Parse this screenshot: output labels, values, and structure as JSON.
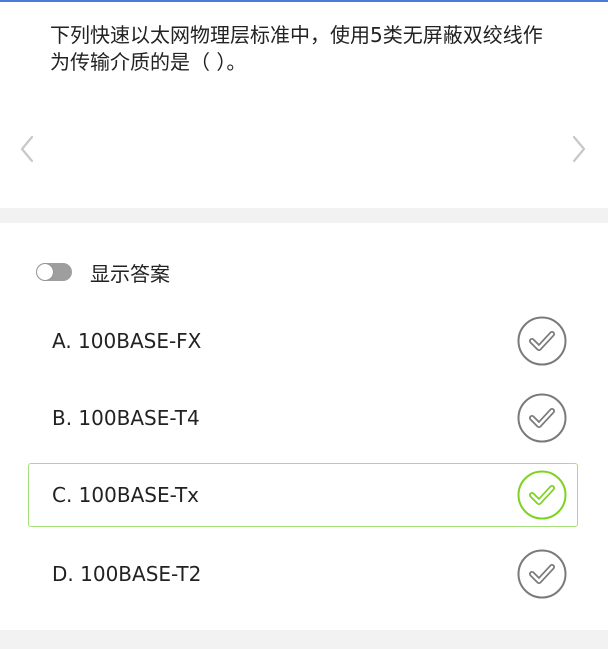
{
  "question": {
    "text": "下列快速以太网物理层标准中，使用5类无屏蔽双绞线作为传输介质的是（ ）。"
  },
  "nav": {
    "prev_icon": "chevron-left-icon",
    "next_icon": "chevron-right-icon"
  },
  "answer_toggle": {
    "label": "显示答案",
    "enabled": false
  },
  "options": [
    {
      "label": "A. 100BASE-FX",
      "selected": false
    },
    {
      "label": "B. 100BASE-T4",
      "selected": false
    },
    {
      "label": "C. 100BASE-Tx",
      "selected": true
    },
    {
      "label": "D. 100BASE-T2",
      "selected": false
    }
  ],
  "colors": {
    "accent_top": "#4a7bd8",
    "selected_border": "#a6e07d",
    "selected_check": "#7ed321",
    "default_check": "#7a7a7a",
    "background": "#f2f2f2"
  }
}
